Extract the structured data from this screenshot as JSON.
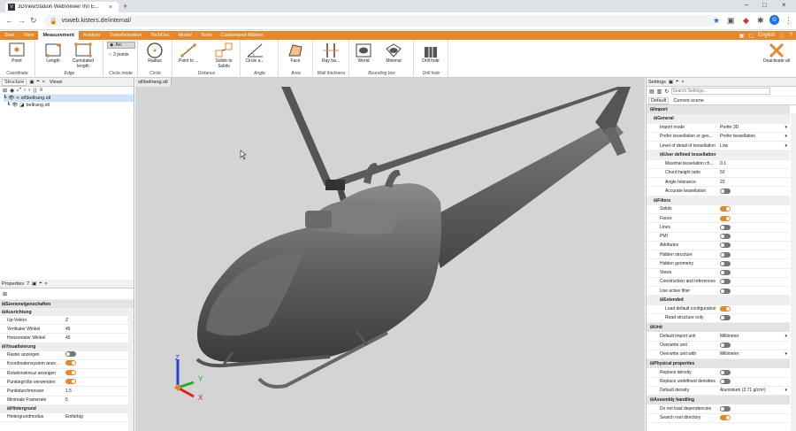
{
  "browser": {
    "tab_title": "3DViewStation WebViewer INTE...",
    "url": "vsweb.kisters.de/internal/",
    "profile_initial": "G"
  },
  "menu": {
    "items": [
      "Start",
      "View",
      "Measurement",
      "Analyze",
      "Transformation",
      "TechDoc",
      "Model",
      "Tools",
      "Customized Ribbon"
    ],
    "active": "Measurement",
    "language": "English"
  },
  "ribbon": {
    "groups": [
      {
        "label": "Coordinate",
        "buttons": [
          "Point"
        ]
      },
      {
        "label": "Edge",
        "buttons": [
          "Length",
          "Cumulated length"
        ]
      },
      {
        "label": "Circle mode",
        "buttons": [
          "Arc",
          "3 points"
        ]
      },
      {
        "label": "Circle",
        "buttons": [
          "Radius"
        ]
      },
      {
        "label": "Distance",
        "buttons": [
          "Point to ...",
          "Solids to Solids"
        ]
      },
      {
        "label": "Angle",
        "buttons": [
          "Circle a..."
        ]
      },
      {
        "label": "Area",
        "buttons": [
          "Face"
        ]
      },
      {
        "label": "Wall thickness",
        "buttons": [
          "Ray ba..."
        ]
      },
      {
        "label": "Bounding box",
        "buttons": [
          "World",
          "Minimal"
        ]
      },
      {
        "label": "Drill hole",
        "buttons": [
          "Drill hole"
        ]
      }
    ],
    "deactivate": "Deactivate all"
  },
  "structure": {
    "tabs": [
      "Structure",
      "Views"
    ],
    "tree": [
      {
        "label": "stl\\bellrang.stl",
        "selected": true
      },
      {
        "label": "bellrang.stl",
        "selected": false
      }
    ]
  },
  "properties": {
    "title": "Properties",
    "section": "Szeneneigenschaften",
    "groups": [
      {
        "name": "Ausrichtung",
        "rows": [
          {
            "k": "Up-Vektor",
            "v": "Z",
            "type": "select"
          },
          {
            "k": "Vertikaler Winkel",
            "v": "45",
            "type": "text"
          },
          {
            "k": "Horizontaler Winkel",
            "v": "45",
            "type": "text"
          }
        ]
      },
      {
        "name": "Visualisierung",
        "rows": [
          {
            "k": "Raster anzeigen",
            "v": false,
            "type": "toggle"
          },
          {
            "k": "Koordinatensystem anze...",
            "v": true,
            "type": "toggle"
          },
          {
            "k": "Rotationskreuz anzeigen",
            "v": true,
            "type": "toggle"
          },
          {
            "k": "Punktegröße verwenden",
            "v": true,
            "type": "toggle"
          },
          {
            "k": "Punktdurchmesser",
            "v": "1.5",
            "type": "text"
          },
          {
            "k": "Minimale Framerate",
            "v": "5",
            "type": "text"
          }
        ]
      }
    ],
    "subgroup": "Hintergrund",
    "last_row": {
      "k": "Hintergrundmodus",
      "v": "Einfarbig"
    }
  },
  "viewport": {
    "tab": "stl\\bellrang.stl",
    "axes": {
      "x": "X",
      "y": "Y",
      "z": "Z"
    }
  },
  "settings": {
    "title": "Settings",
    "search_placeholder": "Search Settings...",
    "tabs": [
      "Default",
      "Current scene"
    ],
    "import_label": "Import",
    "general_label": "General",
    "general": [
      {
        "k": "Import mode",
        "v": "Prefer 3D",
        "type": "select"
      },
      {
        "k": "Prefer tessellation or geo...",
        "v": "Prefer tessellation",
        "type": "select"
      },
      {
        "k": "Level of detail of tessellation",
        "v": "Low",
        "type": "select"
      }
    ],
    "udt_label": "User defined tessellation",
    "udt": [
      {
        "k": "Maximal tesselation ch...",
        "v": "0.1",
        "type": "text"
      },
      {
        "k": "Chord height ratio",
        "v": "50",
        "type": "text"
      },
      {
        "k": "Angle tolerance",
        "v": "20",
        "type": "text"
      },
      {
        "k": "Accurate tessellation",
        "v": false,
        "type": "toggle"
      }
    ],
    "filters_label": "Filters",
    "filters": [
      {
        "k": "Solids",
        "v": true
      },
      {
        "k": "Faces",
        "v": true
      },
      {
        "k": "Lines",
        "v": false
      },
      {
        "k": "PMI",
        "v": false
      },
      {
        "k": "Attributes",
        "v": false
      },
      {
        "k": "Hidden structure",
        "v": false
      },
      {
        "k": "Hidden geometry",
        "v": false
      },
      {
        "k": "Views",
        "v": false
      },
      {
        "k": "Construction and references",
        "v": false
      },
      {
        "k": "Use active filter",
        "v": false
      }
    ],
    "extended_label": "Extended",
    "extended": [
      {
        "k": "Load default configuration",
        "v": true
      },
      {
        "k": "Read structure only",
        "v": false
      }
    ],
    "unit_label": "Unit",
    "unit": [
      {
        "k": "Default import unit",
        "v": "Millimeter",
        "type": "select"
      },
      {
        "k": "Overwrite unit",
        "v": false,
        "type": "toggle"
      },
      {
        "k": "Overwrite unit with",
        "v": "Millimeter",
        "type": "select"
      }
    ],
    "physical_label": "Physical properties",
    "physical": [
      {
        "k": "Replace density",
        "v": false,
        "type": "toggle"
      },
      {
        "k": "Replace undefined densities",
        "v": false,
        "type": "toggle"
      },
      {
        "k": "Default density",
        "v": "Aluminium (2.71 g/cm³)",
        "type": "select"
      }
    ],
    "assembly_label": "Assembly handling",
    "assembly": [
      {
        "k": "Do not load dependencies",
        "v": false,
        "type": "toggle"
      },
      {
        "k": "Search root directory",
        "v": true,
        "type": "toggle"
      }
    ]
  }
}
